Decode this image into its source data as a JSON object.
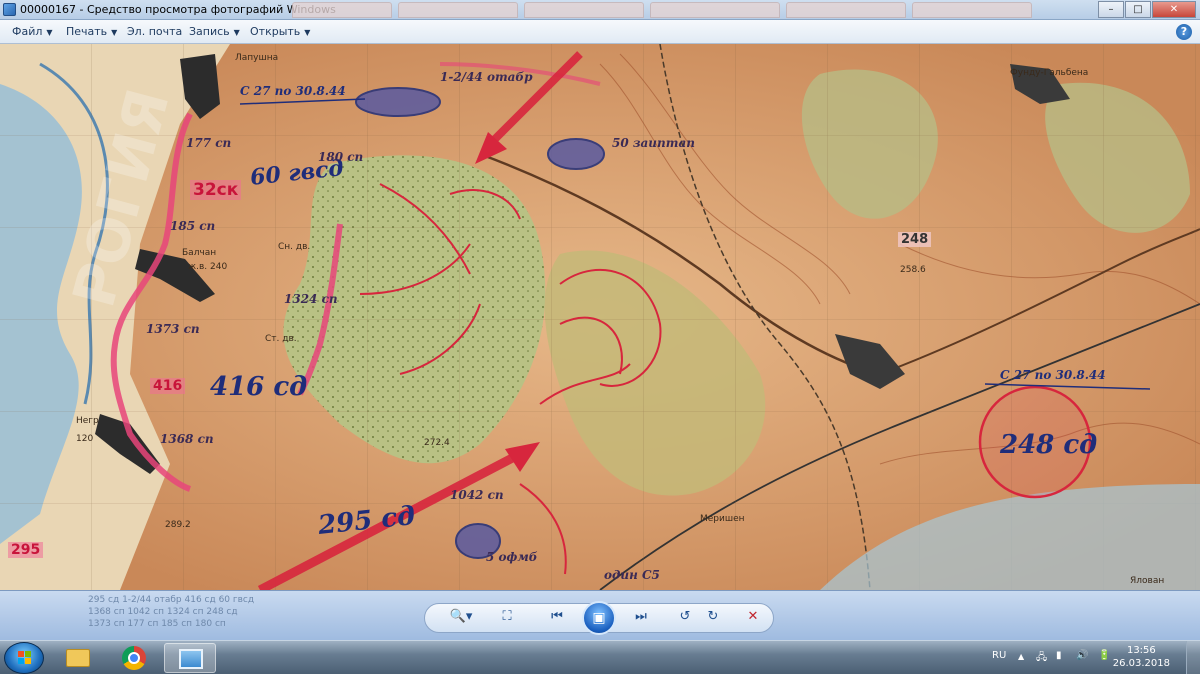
{
  "window": {
    "title": "00000167 - Средство просмотра фотографий Windows",
    "controls": {
      "minimize": "–",
      "maximize": "□",
      "close": "✕"
    }
  },
  "menu": {
    "items": [
      {
        "label": "Файл"
      },
      {
        "label": "Печать"
      },
      {
        "label": "Эл. почта"
      },
      {
        "label": "Запись"
      },
      {
        "label": "Открыть"
      }
    ],
    "help_icon": "help-icon",
    "help_glyph": "?"
  },
  "map": {
    "places": {
      "lapushna": "Лапушна",
      "balchan": "Балчан",
      "negr": "Негр",
      "fundu_galbena": "Фунду-Гальбена",
      "merishen": "Меришен",
      "ialoveni": "Ялован"
    },
    "unit_labels": {
      "guards_60": "60 гвсд",
      "sk_32": "32ск",
      "sd_416": "416 сд",
      "sd_295": "295 сд",
      "sd_248": "248 сд",
      "box_416": "416",
      "box_295": "295",
      "box_248": "248"
    },
    "red_labels": {
      "sp_177": "177 сп",
      "sp_185": "185 сп",
      "sp_180": "180 сп",
      "sp_1324": "1324 сп",
      "sp_1373": "1373 сп",
      "sp_1368": "1368 сп",
      "sp_1042": "1042 сп",
      "otabr": "1-2/44 отабр",
      "aiptap": "50 заиптап",
      "ofmb": "5 офмб",
      "odn": "один С5"
    },
    "date_labels": {
      "d1": "С 27 по 30.8.44",
      "d2": "С 27 по 30.8.44"
    },
    "heights": [
      "ж.в. 240",
      "Сн. дв.",
      "Ст. дв.",
      "258.6",
      "289.2",
      "272.4",
      "120"
    ]
  },
  "controls": {
    "zoom": "🔍▾",
    "fit": "⛶",
    "prev": "⏮",
    "slideshow": "▣",
    "next": "⏭",
    "rotate_ccw": "↺",
    "rotate_cw": "↻",
    "delete": "✕",
    "faded_text": [
      "295 сд 1-2/44 отабр 416 сд 60 гвсд",
      "1368 сп 1042 сп 1324 сп 248 сд",
      "1373 сп 177 сп 185 сп 180 сп"
    ]
  },
  "taskbar": {
    "apps": [
      {
        "name": "explorer"
      },
      {
        "name": "chrome"
      },
      {
        "name": "photo-viewer",
        "active": true
      }
    ],
    "tray": {
      "lang": "RU",
      "chevron": "▲",
      "icons": [
        "network-icon",
        "signal-icon",
        "volume-icon",
        "power-icon"
      ]
    },
    "clock": {
      "time": "13:56",
      "date": "26.03.2018"
    }
  }
}
